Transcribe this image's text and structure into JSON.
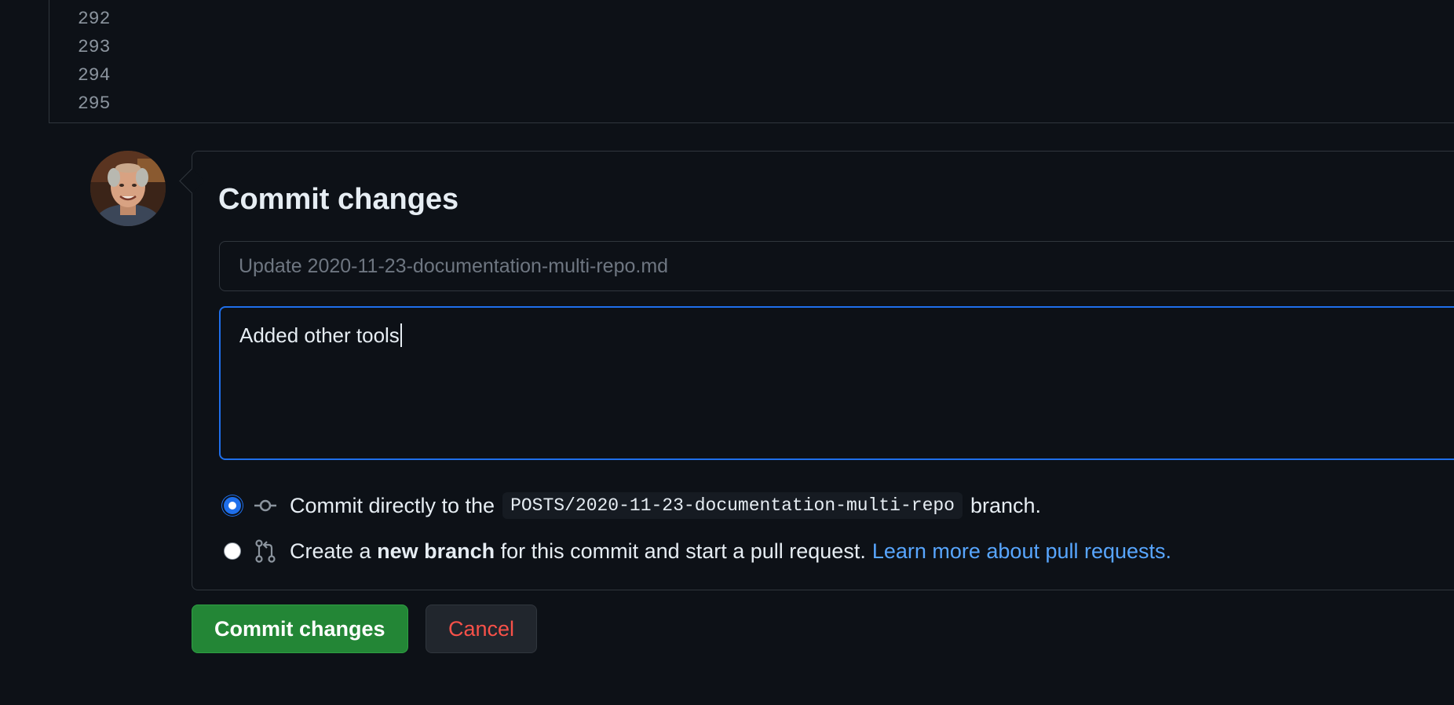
{
  "editor": {
    "line_numbers": [
      "292",
      "293",
      "294",
      "295"
    ]
  },
  "commit_form": {
    "title": "Commit changes",
    "summary_placeholder": "Update 2020-11-23-documentation-multi-repo.md",
    "description_value": "Added other tools",
    "option_direct": {
      "prefix": "Commit directly to the",
      "branch": "POSTS/2020-11-23-documentation-multi-repo",
      "suffix": "branch.",
      "selected": true,
      "icon": "git-commit-icon"
    },
    "option_new_branch": {
      "prefix": "Create a",
      "bold": "new branch",
      "suffix": "for this commit and start a pull request.",
      "link": "Learn more about pull requests.",
      "selected": false,
      "icon": "git-pull-request-icon"
    }
  },
  "buttons": {
    "commit_label": "Commit changes",
    "cancel_label": "Cancel"
  },
  "colors": {
    "background": "#0d1117",
    "accent_blue": "#1f6feb",
    "link_blue": "#58a6ff",
    "commit_green": "#238636",
    "cancel_red": "#f85149"
  }
}
